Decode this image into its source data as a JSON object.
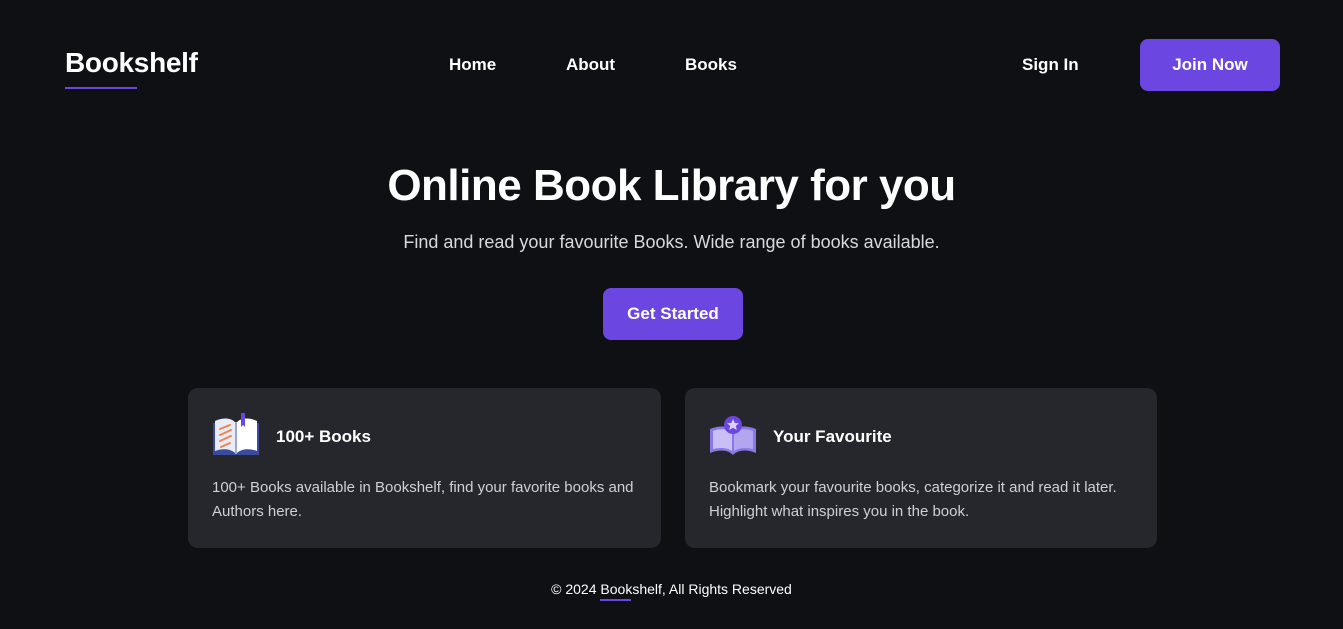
{
  "header": {
    "logo": "Bookshelf",
    "nav": [
      {
        "label": "Home"
      },
      {
        "label": "About"
      },
      {
        "label": "Books"
      }
    ],
    "sign_in": "Sign In",
    "join_now": "Join Now"
  },
  "hero": {
    "title": "Online Book Library for you",
    "subtitle": "Find and read your favourite Books. Wide range of books available.",
    "cta": "Get Started"
  },
  "features": [
    {
      "icon": "open-book-icon",
      "title": "100+ Books",
      "text": "100+ Books available in Bookshelf, find your favorite books and Authors here."
    },
    {
      "icon": "bookmark-book-icon",
      "title": "Your Favourite",
      "text": "Bookmark your favourite books, categorize it and read it later. Highlight what inspires you in the book."
    }
  ],
  "footer": {
    "prefix": "© 2024 ",
    "brand": "Bookshelf",
    "suffix": ", All Rights Reserved"
  },
  "colors": {
    "background": "#0f1014",
    "accent": "#6b46e0",
    "card": "#26272c"
  }
}
